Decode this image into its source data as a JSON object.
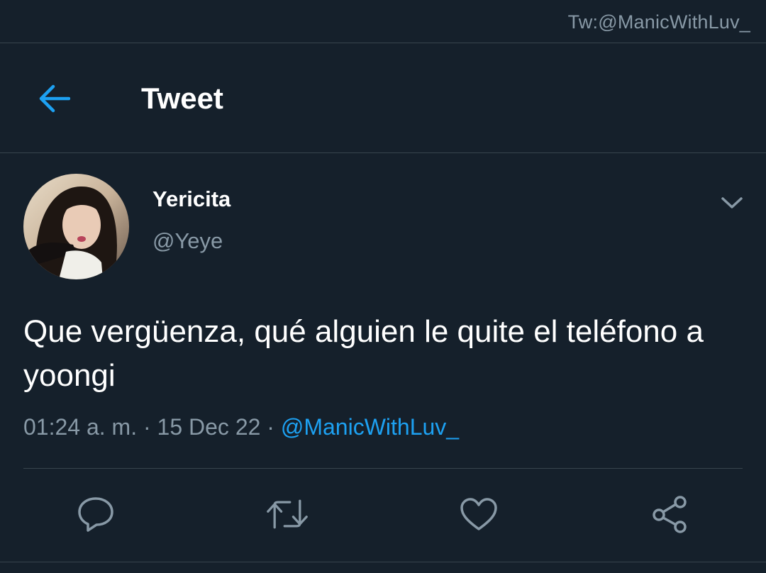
{
  "watermark": "Tw:@ManicWithLuv_",
  "header": {
    "title": "Tweet"
  },
  "tweet": {
    "display_name": "Yericita",
    "handle": "@Yeye",
    "text": "Que vergüenza, qué alguien le quite el teléfono a yoongi",
    "time": "01:24 a. m.",
    "separator": " · ",
    "date": "15 Dec 22",
    "source": "@ManicWithLuv_"
  },
  "icons": {
    "back": "arrow-left-icon",
    "menu": "chevron-down-icon",
    "reply": "reply-icon",
    "retweet": "retweet-icon",
    "like": "heart-icon",
    "share": "share-icon"
  },
  "colors": {
    "background": "#15202b",
    "accent": "#1da1f2",
    "secondary_text": "#8899a6",
    "divider": "#38444d"
  }
}
